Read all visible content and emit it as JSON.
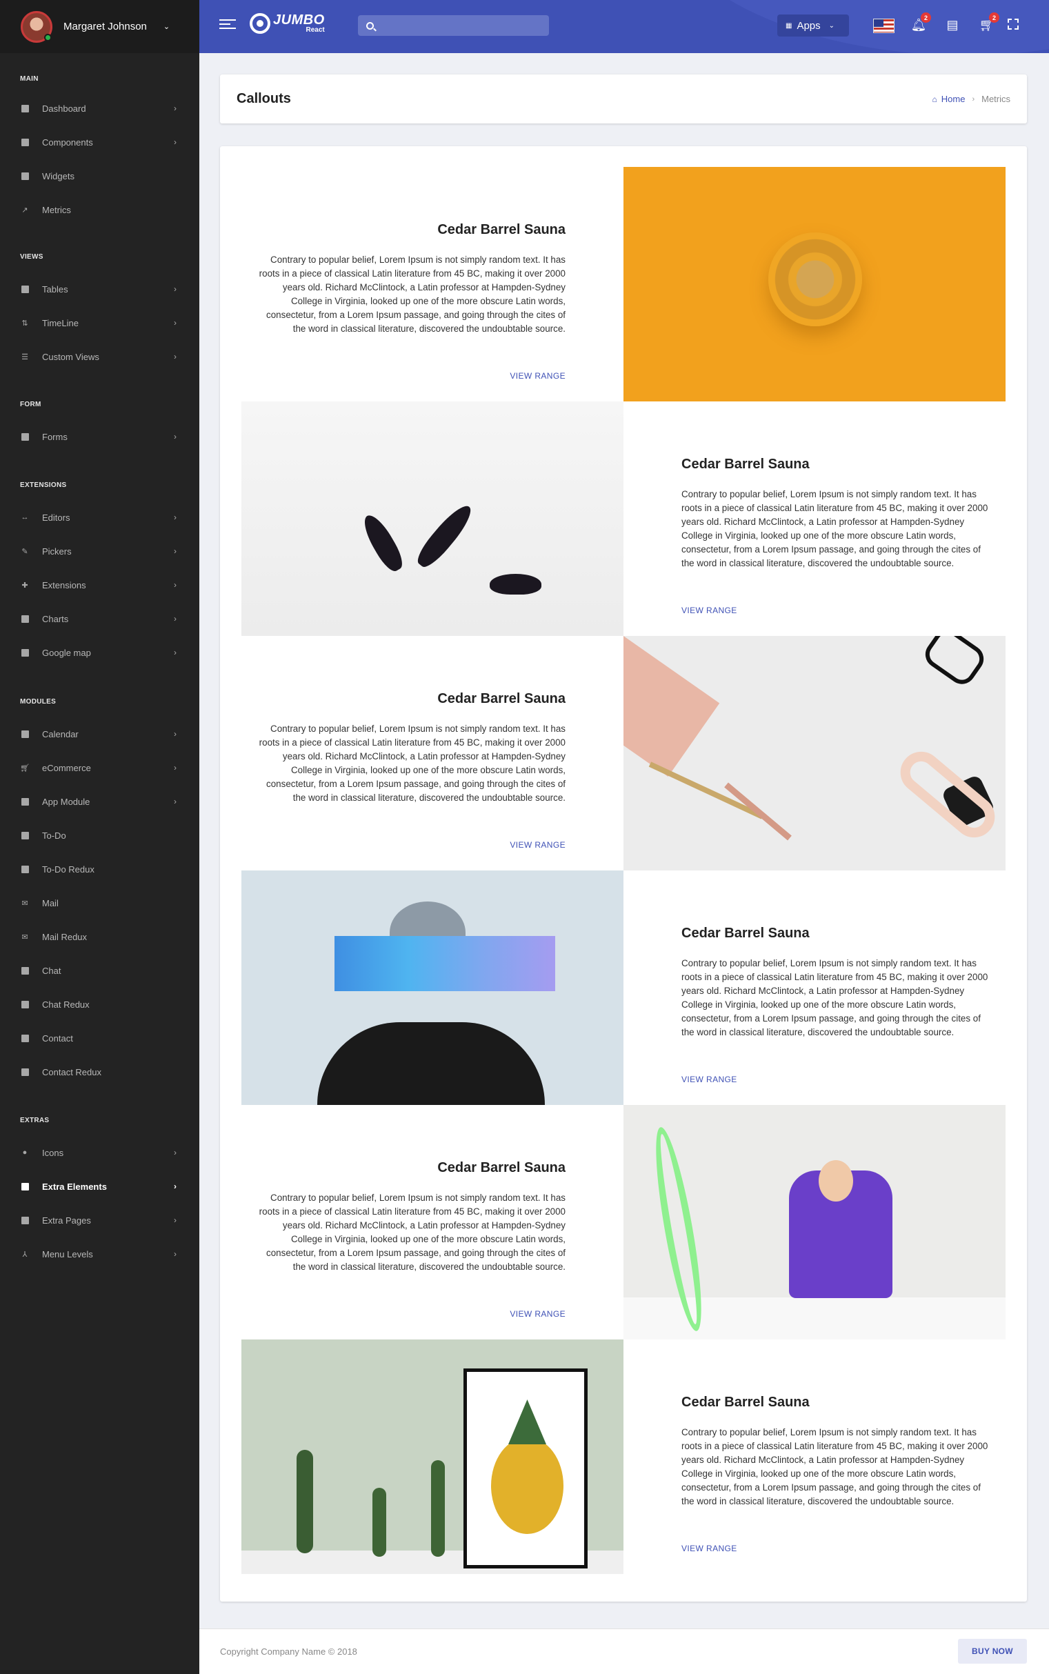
{
  "user": {
    "name": "Margaret Johnson"
  },
  "sidebar": {
    "sections": {
      "main": "MAIN",
      "views": "VIEWS",
      "form": "FORM",
      "extensions": "EXTENSIONS",
      "modules": "MODULES",
      "extras": "EXTRAS"
    },
    "items": {
      "dashboard": "Dashboard",
      "components": "Components",
      "widgets": "Widgets",
      "metrics": "Metrics",
      "tables": "Tables",
      "timeline": "TimeLine",
      "custom_views": "Custom Views",
      "forms": "Forms",
      "editors": "Editors",
      "pickers": "Pickers",
      "extensions": "Extensions",
      "charts": "Charts",
      "google_map": "Google map",
      "calendar": "Calendar",
      "ecommerce": "eCommerce",
      "app_module": "App Module",
      "todo": "To-Do",
      "todo_redux": "To-Do Redux",
      "mail": "Mail",
      "mail_redux": "Mail Redux",
      "chat": "Chat",
      "chat_redux": "Chat Redux",
      "contact": "Contact",
      "contact_redux": "Contact Redux",
      "icons": "Icons",
      "extra_elements": "Extra Elements",
      "extra_pages": "Extra Pages",
      "menu_levels": "Menu Levels"
    }
  },
  "header": {
    "logo_title": "JUMBO",
    "logo_sub": "React",
    "search_placeholder": "",
    "apps_label": "Apps",
    "notifications_count": "2",
    "cart_count": "2"
  },
  "page": {
    "title": "Callouts",
    "breadcrumb_home": "Home",
    "breadcrumb_current": "Metrics"
  },
  "callouts": [
    {
      "title": "Cedar Barrel Sauna",
      "desc": "Contrary to popular belief, Lorem Ipsum is not simply random text. It has roots in a piece of classical Latin literature from 45 BC, making it over 2000 years old. Richard McClintock, a Latin professor at Hampden-Sydney College in Virginia, looked up one of the more obscure Latin words, consectetur, from a Lorem Ipsum passage, and going through the cites of the word in classical literature, discovered the undoubtable source.",
      "link": "VIEW RANGE"
    },
    {
      "title": "Cedar Barrel Sauna",
      "desc": "Contrary to popular belief, Lorem Ipsum is not simply random text. It has roots in a piece of classical Latin literature from 45 BC, making it over 2000 years old. Richard McClintock, a Latin professor at Hampden-Sydney College in Virginia, looked up one of the more obscure Latin words, consectetur, from a Lorem Ipsum passage, and going through the cites of the word in classical literature, discovered the undoubtable source.",
      "link": "VIEW RANGE"
    },
    {
      "title": "Cedar Barrel Sauna",
      "desc": "Contrary to popular belief, Lorem Ipsum is not simply random text. It has roots in a piece of classical Latin literature from 45 BC, making it over 2000 years old. Richard McClintock, a Latin professor at Hampden-Sydney College in Virginia, looked up one of the more obscure Latin words, consectetur, from a Lorem Ipsum passage, and going through the cites of the word in classical literature, discovered the undoubtable source.",
      "link": "VIEW RANGE"
    },
    {
      "title": "Cedar Barrel Sauna",
      "desc": "Contrary to popular belief, Lorem Ipsum is not simply random text. It has roots in a piece of classical Latin literature from 45 BC, making it over 2000 years old. Richard McClintock, a Latin professor at Hampden-Sydney College in Virginia, looked up one of the more obscure Latin words, consectetur, from a Lorem Ipsum passage, and going through the cites of the word in classical literature, discovered the undoubtable source.",
      "link": "VIEW RANGE"
    },
    {
      "title": "Cedar Barrel Sauna",
      "desc": "Contrary to popular belief, Lorem Ipsum is not simply random text. It has roots in a piece of classical Latin literature from 45 BC, making it over 2000 years old. Richard McClintock, a Latin professor at Hampden-Sydney College in Virginia, looked up one of the more obscure Latin words, consectetur, from a Lorem Ipsum passage, and going through the cites of the word in classical literature, discovered the undoubtable source.",
      "link": "VIEW RANGE"
    },
    {
      "title": "Cedar Barrel Sauna",
      "desc": "Contrary to popular belief, Lorem Ipsum is not simply random text. It has roots in a piece of classical Latin literature from 45 BC, making it over 2000 years old. Richard McClintock, a Latin professor at Hampden-Sydney College in Virginia, looked up one of the more obscure Latin words, consectetur, from a Lorem Ipsum passage, and going through the cites of the word in classical literature, discovered the undoubtable source.",
      "link": "VIEW RANGE"
    }
  ],
  "footer": {
    "copyright": "Copyright Company Name © 2018",
    "buy_now": "BUY NOW"
  },
  "colors": {
    "primary": "#3f51b5",
    "sidebar": "#232323",
    "badge": "#e53935"
  }
}
